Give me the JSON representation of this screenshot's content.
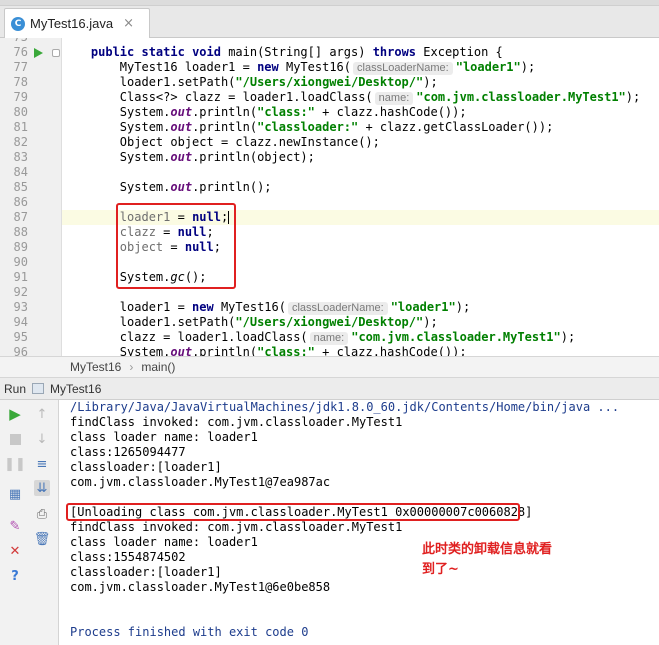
{
  "tab": {
    "icon_letter": "C",
    "label": "MyTest16.java",
    "close": "×"
  },
  "editor": {
    "line_numbers": [
      "75",
      "76",
      "77",
      "78",
      "79",
      "80",
      "81",
      "82",
      "83",
      "84",
      "85",
      "86",
      "87",
      "88",
      "89",
      "90",
      "91",
      "92",
      "93",
      "94",
      "95",
      "96"
    ],
    "lines": [
      [],
      [
        [
          "    ",
          ""
        ],
        [
          "public ",
          "kw"
        ],
        [
          "static ",
          "kw"
        ],
        [
          "void ",
          "kw"
        ],
        [
          "main(String[] args) ",
          ""
        ],
        [
          "throws ",
          "kw"
        ],
        [
          "Exception {",
          ""
        ]
      ],
      [
        [
          "        MyTest16 loader1 = ",
          ""
        ],
        [
          "new ",
          "kw"
        ],
        [
          "MyTest16(",
          ""
        ],
        [
          "classLoaderName:",
          "hint"
        ],
        [
          "\"loader1\"",
          "str"
        ],
        [
          ");",
          ""
        ]
      ],
      [
        [
          "        loader1.setPath(",
          ""
        ],
        [
          "\"/Users/xiongwei/Desktop/\"",
          "str"
        ],
        [
          ");",
          ""
        ]
      ],
      [
        [
          "        Class<?> clazz = loader1.loadClass(",
          ""
        ],
        [
          "name:",
          "hint"
        ],
        [
          "\"com.jvm.classloader.MyTest1\"",
          "str"
        ],
        [
          ");",
          ""
        ]
      ],
      [
        [
          "        System.",
          ""
        ],
        [
          "out",
          "fld"
        ],
        [
          ".println(",
          ""
        ],
        [
          "\"class:\"",
          "str"
        ],
        [
          " + clazz.hashCode());",
          ""
        ]
      ],
      [
        [
          "        System.",
          ""
        ],
        [
          "out",
          "fld"
        ],
        [
          ".println(",
          ""
        ],
        [
          "\"classloader:\"",
          "str"
        ],
        [
          " + clazz.getClassLoader());",
          ""
        ]
      ],
      [
        [
          "        Object object = clazz.newInstance();",
          ""
        ]
      ],
      [
        [
          "        System.",
          ""
        ],
        [
          "out",
          "fld"
        ],
        [
          ".println(object);",
          ""
        ]
      ],
      [],
      [
        [
          "        System.",
          ""
        ],
        [
          "out",
          "fld"
        ],
        [
          ".println();",
          ""
        ]
      ],
      [],
      [
        [
          "        ",
          ""
        ],
        [
          "loader1",
          "gray"
        ],
        [
          " = ",
          ""
        ],
        [
          "null",
          "kw"
        ],
        [
          ";",
          ""
        ],
        [
          "|",
          "caret"
        ]
      ],
      [
        [
          "        ",
          ""
        ],
        [
          "clazz",
          "gray"
        ],
        [
          " = ",
          ""
        ],
        [
          "null",
          "kw"
        ],
        [
          ";",
          ""
        ]
      ],
      [
        [
          "        ",
          ""
        ],
        [
          "object",
          "gray"
        ],
        [
          " = ",
          ""
        ],
        [
          "null",
          "kw"
        ],
        [
          ";",
          ""
        ]
      ],
      [],
      [
        [
          "        System.",
          ""
        ],
        [
          "gc",
          "it"
        ],
        [
          "();",
          ""
        ]
      ],
      [],
      [
        [
          "        loader1 = ",
          ""
        ],
        [
          "new ",
          "kw"
        ],
        [
          "MyTest16(",
          ""
        ],
        [
          "classLoaderName:",
          "hint"
        ],
        [
          "\"loader1\"",
          "str"
        ],
        [
          ");",
          ""
        ]
      ],
      [
        [
          "        loader1.setPath(",
          ""
        ],
        [
          "\"/Users/xiongwei/Desktop/\"",
          "str"
        ],
        [
          ");",
          ""
        ]
      ],
      [
        [
          "        clazz = loader1.loadClass(",
          ""
        ],
        [
          "name:",
          "hint"
        ],
        [
          "\"com.jvm.classloader.MyTest1\"",
          "str"
        ],
        [
          ");",
          ""
        ]
      ],
      [
        [
          "        System.",
          ""
        ],
        [
          "out",
          "fld"
        ],
        [
          ".println(",
          ""
        ],
        [
          "\"class:\"",
          "str"
        ],
        [
          " + clazz.hashCode());",
          ""
        ]
      ]
    ]
  },
  "breadcrumb": {
    "class": "MyTest16",
    "separator": "›",
    "method": "main()"
  },
  "run_panel": {
    "label": "Run",
    "config": "MyTest16"
  },
  "console": {
    "lines": [
      "/Library/Java/JavaVirtualMachines/jdk1.8.0_60.jdk/Contents/Home/bin/java ...",
      "findClass invoked: com.jvm.classloader.MyTest1",
      "class loader name: loader1",
      "class:1265094477",
      "classloader:[loader1]",
      "com.jvm.classloader.MyTest1@7ea987ac",
      "",
      "[Unloading class com.jvm.classloader.MyTest1 0x00000007c0060828]",
      "findClass invoked: com.jvm.classloader.MyTest1",
      "class loader name: loader1",
      "class:1554874502",
      "classloader:[loader1]",
      "com.jvm.classloader.MyTest1@6e0be858",
      "",
      "",
      "Process finished with exit code 0"
    ],
    "annotation_line1": "此时类的卸载信息就看",
    "annotation_line2": "到了~"
  },
  "colors": {
    "keyword": "#000080",
    "string": "#008000",
    "highlight_box": "#e02020",
    "run_green": "#3aa83a"
  },
  "icons": [
    "class-file-icon",
    "run-gutter-icon",
    "rerun-icon",
    "stop-icon",
    "pause-icon",
    "scroll-up-icon",
    "scroll-down-icon",
    "soft-wrap-icon",
    "scroll-to-end-icon",
    "print-icon",
    "trash-icon",
    "layout-icon",
    "pin-icon",
    "close-icon",
    "help-icon"
  ]
}
